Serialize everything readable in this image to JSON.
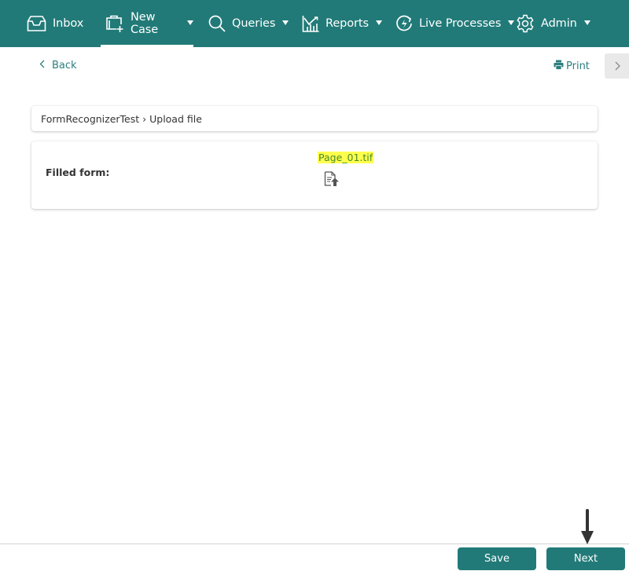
{
  "nav": {
    "items": [
      {
        "label": "Inbox",
        "icon": "inbox-icon",
        "has_dropdown": false,
        "active": false
      },
      {
        "label": "New Case",
        "icon": "new-case-icon",
        "has_dropdown": true,
        "active": true
      },
      {
        "label": "Queries",
        "icon": "search-icon",
        "has_dropdown": true,
        "active": false
      },
      {
        "label": "Reports",
        "icon": "reports-chart-icon",
        "has_dropdown": true,
        "active": false
      },
      {
        "label": "Live Processes",
        "icon": "live-processes-icon",
        "has_dropdown": true,
        "active": false
      },
      {
        "label": "Admin",
        "icon": "gear-icon",
        "has_dropdown": true,
        "active": false
      }
    ],
    "background": "#217a78"
  },
  "toolbar": {
    "back_label": "Back",
    "print_label": "Print"
  },
  "breadcrumb": {
    "text": "FormRecognizerTest › Upload file"
  },
  "form": {
    "fields": [
      {
        "label": "Filled form:",
        "file_name": "Page_01.tif"
      }
    ]
  },
  "footer": {
    "save_label": "Save",
    "next_label": "Next"
  },
  "colors": {
    "accent": "#217a78",
    "link": "#2a7f7d",
    "highlight": "#ffff4d"
  }
}
